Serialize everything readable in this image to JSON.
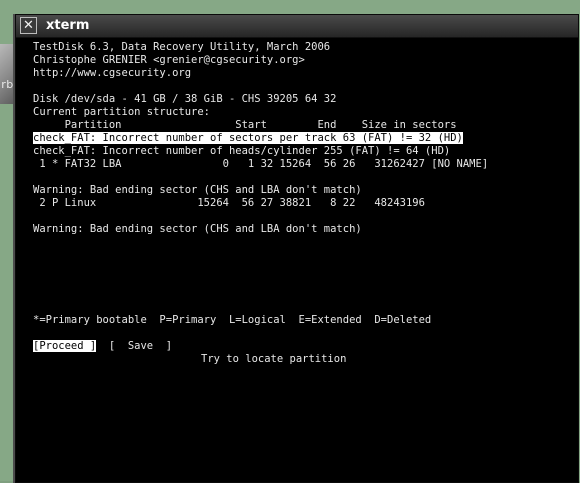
{
  "window": {
    "title": "xterm",
    "close_glyph": "✕"
  },
  "desktop": {
    "icon_label": "arb"
  },
  "terminal": {
    "header": [
      "TestDisk 6.3, Data Recovery Utility, March 2006",
      "Christophe GRENIER <grenier@cgsecurity.org>",
      "http://www.cgsecurity.org"
    ],
    "disk_info": "Disk /dev/sda - 41 GB / 38 GiB - CHS 39205 64 32",
    "structure_title": "Current partition structure:",
    "column_header": "     Partition                  Start        End    Size in sectors",
    "selected_warning": "check_FAT: Incorrect number of sectors per track 63 (FAT) != 32 (HD)",
    "warning_heads": "check_FAT: Incorrect number of heads/cylinder 255 (FAT) != 64 (HD)",
    "partition_1": " 1 * FAT32 LBA                0   1 32 15264  56 26   31262427 [NO NAME]",
    "warning_1": "Warning: Bad ending sector (CHS and LBA don't match)",
    "partition_2": " 2 P Linux                15264  56 27 38821   8 22   48243196",
    "warning_2": "Warning: Bad ending sector (CHS and LBA don't match)",
    "legend": "*=Primary bootable  P=Primary  L=Logical  E=Extended  D=Deleted",
    "proceed_label": "[Proceed ]",
    "save_label": "[  Save  ]",
    "hint": "Try to locate partition"
  }
}
